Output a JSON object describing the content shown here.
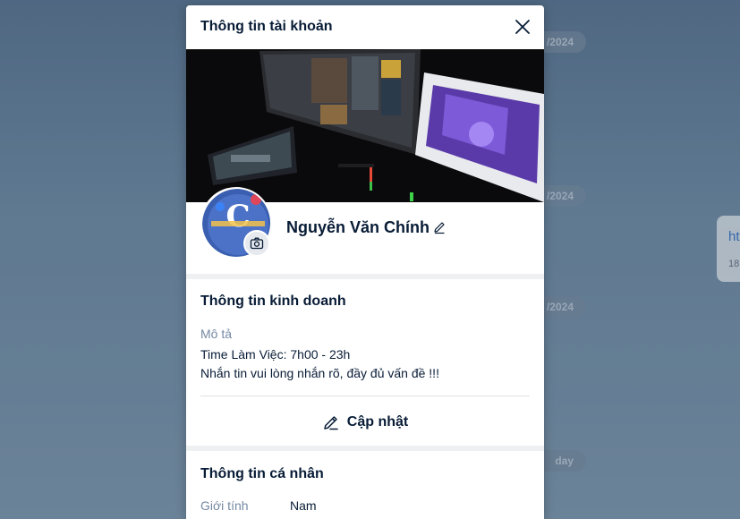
{
  "background": {
    "date_pills": [
      "/2024",
      "/2024",
      "/2024",
      "day"
    ],
    "card_link": "ht",
    "card_small": "18"
  },
  "modal": {
    "title": "Thông tin tài khoản",
    "profile": {
      "name": "Nguyễn Văn Chính"
    },
    "business": {
      "title": "Thông tin kinh doanh",
      "desc_label": "Mô tả",
      "lines": [
        "Time Làm Việc: 7h00 - 23h",
        "Nhắn tin vui lòng nhắn rõ, đầy đủ vấn đề !!!"
      ],
      "update_label": "Cập nhật"
    },
    "personal": {
      "title": "Thông tin cá nhân",
      "gender_label": "Giới tính",
      "gender_value": "Nam"
    }
  },
  "colors": {
    "text_primary": "#081c36",
    "text_muted": "#7589a3",
    "separator": "#eef0f1",
    "link": "#2a6fd0"
  },
  "icons": [
    "close-icon",
    "camera-icon",
    "pencil-icon",
    "edit-icon"
  ]
}
